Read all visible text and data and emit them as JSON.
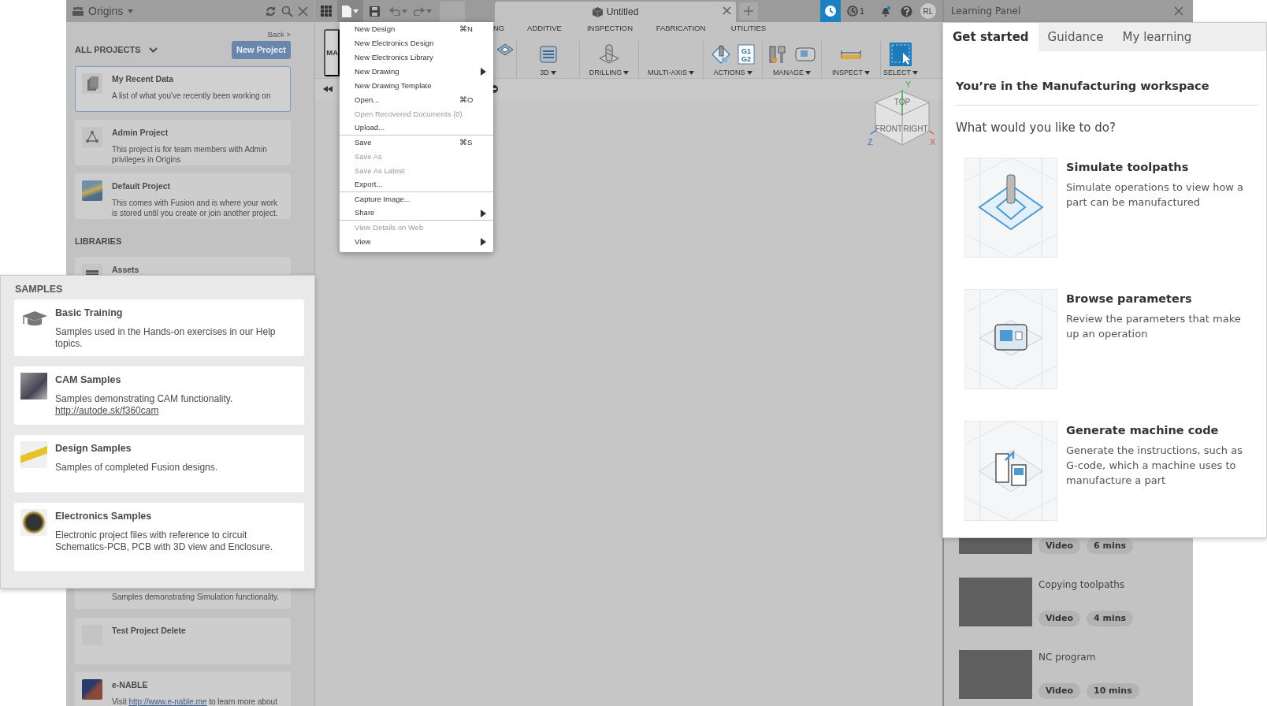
{
  "data_panel": {
    "team": "Origins",
    "back": "Back >",
    "section": "ALL PROJECTS",
    "new_project": "New Project",
    "projects": [
      {
        "title": "My Recent Data",
        "description": "A list of what you've recently been working on",
        "selected": true
      },
      {
        "title": "Admin Project",
        "description": "This project is for team members with Admin privileges in Origins",
        "selected": false
      },
      {
        "title": "Default Project",
        "description": "This comes with Fusion and is where your work is stored until you create or join another project.",
        "selected": false
      }
    ],
    "libraries_heading": "LIBRARIES",
    "libraries": [
      {
        "title": "Assets"
      }
    ],
    "more_projects": [
      {
        "description": "Samples demonstrating Simulation functionality."
      },
      {
        "title": "Test Project Delete"
      },
      {
        "title": "e-NABLE",
        "description_parts": [
          {
            "text": "Visit "
          },
          {
            "link": "http://www.e-nable.me"
          },
          {
            "text": " to learn more about"
          }
        ]
      }
    ]
  },
  "samples": {
    "heading": "SAMPLES",
    "items": [
      {
        "title": "Basic Training",
        "description": "Samples used in the Hands-on exercises in our Help topics."
      },
      {
        "title": "CAM Samples",
        "description": "Samples demonstrating CAM functionality.",
        "link": "http://autode.sk/f360cam"
      },
      {
        "title": "Design Samples",
        "description": "Samples of completed Fusion designs."
      },
      {
        "title": "Electronics Samples",
        "description": "Electronic project files with reference to circuit Schematics-PCB, PCB with 3D view and Enclosure."
      }
    ]
  },
  "toolbar": {
    "document_tab": "Untitled",
    "job_count": "1",
    "user_initials": "RL"
  },
  "ribbon": {
    "workspace": "MA",
    "tabs": [
      {
        "label": "NG"
      },
      {
        "label": "ADDITIVE"
      },
      {
        "label": "INSPECTION"
      },
      {
        "label": "FABRICATION"
      },
      {
        "label": "UTILITIES"
      }
    ],
    "groups": [
      {
        "label": "3D"
      },
      {
        "label": "DRILLING"
      },
      {
        "label": "MULTI-AXIS"
      },
      {
        "label": "ACTIONS",
        "icon_labels": [
          "G1",
          "G2"
        ]
      },
      {
        "label": "MANAGE"
      },
      {
        "label": "INSPECT"
      },
      {
        "label": "SELECT"
      }
    ]
  },
  "file_menu": {
    "items": [
      {
        "label": "New Design",
        "shortcut": "⌘N",
        "disabled": false,
        "submenu": false,
        "separator_after": false
      },
      {
        "label": "New Electronics Design",
        "disabled": false,
        "submenu": false,
        "separator_after": false
      },
      {
        "label": "New Electronics Library",
        "disabled": false,
        "submenu": false,
        "separator_after": false
      },
      {
        "label": "New Drawing",
        "disabled": false,
        "submenu": true,
        "separator_after": false
      },
      {
        "label": "New Drawing Template",
        "disabled": false,
        "submenu": false,
        "separator_after": false
      },
      {
        "label": "Open...",
        "shortcut": "⌘O",
        "disabled": false,
        "submenu": false,
        "separator_after": false
      },
      {
        "label": "Open Recovered Documents (0)",
        "disabled": true,
        "submenu": false,
        "separator_after": false
      },
      {
        "label": "Upload...",
        "disabled": false,
        "submenu": false,
        "separator_after": true
      },
      {
        "label": "Save",
        "shortcut": "⌘S",
        "disabled": false,
        "submenu": false,
        "separator_after": false
      },
      {
        "label": "Save As",
        "disabled": true,
        "submenu": false,
        "separator_after": false
      },
      {
        "label": "Save As Latest",
        "disabled": true,
        "submenu": false,
        "separator_after": false
      },
      {
        "label": "Export...",
        "disabled": false,
        "submenu": false,
        "separator_after": true
      },
      {
        "label": "Capture Image...",
        "disabled": false,
        "submenu": false,
        "separator_after": false
      },
      {
        "label": "Share",
        "disabled": false,
        "submenu": true,
        "separator_after": true
      },
      {
        "label": "View Details on Web",
        "disabled": true,
        "submenu": false,
        "separator_after": false
      },
      {
        "label": "View",
        "disabled": false,
        "submenu": true,
        "separator_after": false
      }
    ]
  },
  "viewcube": {
    "faces": [
      "TOP",
      "FRONT",
      "RIGHT"
    ],
    "axes": [
      "X",
      "Y",
      "Z"
    ]
  },
  "learning_panel": {
    "title": "Learning Panel",
    "tabs": [
      {
        "label": "Get started",
        "selected": true
      },
      {
        "label": "Guidance",
        "selected": false
      },
      {
        "label": "My learning",
        "selected": false
      }
    ],
    "heading": "You’re in the Manufacturing workspace",
    "question": "What would you like to do?",
    "topics": [
      {
        "title": "Simulate toolpaths",
        "description": "Simulate operations to view how a part can be manufactured"
      },
      {
        "title": "Browse parameters",
        "description": "Review the parameters that make up an operation"
      },
      {
        "title": "Generate machine code",
        "description": "Generate the instructions, such as G-code, which a machine uses to manufacture a part"
      }
    ],
    "videos": [
      {
        "tags": [
          "Video",
          "6 mins"
        ]
      },
      {
        "title": "Copying toolpaths",
        "tags": [
          "Video",
          "4 mins"
        ]
      },
      {
        "title": "NC program",
        "tags": [
          "Video",
          "10 mins"
        ]
      }
    ]
  }
}
